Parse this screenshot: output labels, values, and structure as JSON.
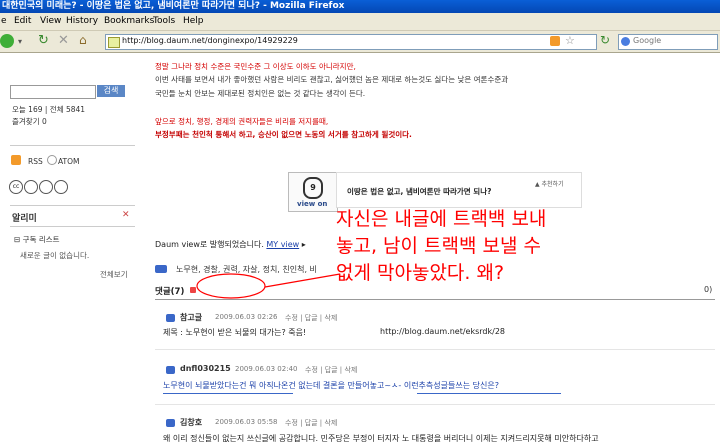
{
  "window": {
    "title": "대한민국의 미래는? - 이땅은 법은 없고, 냄비여론만 따라가면 되나? - Mozilla Firefox"
  },
  "menu": [
    "Edit",
    "View",
    "History",
    "Bookmarks",
    "Tools",
    "Help"
  ],
  "menu_first_partial": "e",
  "toolbar": {
    "url": "http://blog.daum.net/donginexpo/14929229",
    "search_placeholder": "Google"
  },
  "sidebar": {
    "search_button": "검색",
    "stats_today": "오늘 169",
    "stats_total": "전체 5841",
    "favorites": "즐겨찾기 0",
    "rss": "RSS",
    "atom": "ATOM",
    "notice_title": "알리미",
    "subscribe_title": "구독 리스트",
    "subscribe_empty": "새로운 글이 없습니다.",
    "view_all": "전체보기"
  },
  "post": {
    "para1_line1": "정말 그나라 정치 수준은 국민수준 그 이상도 이하도 아니라지만,",
    "para1_line2": "이번 사태를 보면서 내가 좋아했던 사람은 비리도 괜찮고, 싫어했던 놈은 제대로 하는것도 싫다는 낮은 여론수준과",
    "para1_line3": "국민들 눈치 안보는 제대로된 정치인은 없는 것 같다는 생각이 든다.",
    "para2_line1": "앞으로 정치, 행정, 경제의 권력자들은 비리를 저지를때,",
    "para2_line2": "부정부패는 천인척 통해서 하고, 승산이 없으면 노동의 서거를 참고하게 될것이다.",
    "viewon_label": "view on",
    "viewon_count": "9",
    "viewon_title": "이땅은 법은 없고, 냄비여론만 따라가면 되나?",
    "viewon_more": "▲ 추천하기",
    "daum_view_text": "Daum view로 발행되었습니다.",
    "my_view": "MY view",
    "tags": "노무현, 경찰, 권력, 자살, 정치, 친인척, 비",
    "comments_label": "댓글(7)",
    "page_num": "0)"
  },
  "overlay": {
    "line1": "자신은 내글에 트랙백 보내",
    "line2": "놓고, 남이 트랙백 보낼 수",
    "line3": "없게 막아놓았다. 왜?"
  },
  "comments": [
    {
      "author": "참고글",
      "date": "2009.06.03 02:26",
      "actions": "수정 | 답글 | 삭제",
      "body": "제목 : 노무현이 받은 뇌물의 대가는? 죽음!",
      "link": "http://blog.daum.net/eksrdk/28"
    },
    {
      "author": "dnfl030215",
      "date": "2009.06.03 02:40",
      "actions": "수정 | 답글 | 삭제",
      "body": "노무현이 뇌물받았다는건 뭐 아직나온건 없는데 결론을 만들어놓고~ㅅ- 이런추측성글들쓰는 당신은?"
    },
    {
      "author": "김창호",
      "date": "2009.06.03 05:58",
      "actions": "수정 | 답글 | 삭제",
      "body": "왜 이리 정신들이 없는지 쓰신글에 공감합니다. 민주당은 부정이 터지자 노 대통령을 버리더니 이제는 지켜드리지못해 미안하다하고"
    }
  ],
  "colors": {
    "accent_red": "#d40000",
    "link_blue": "#1a3fa8",
    "overlay_red": "#ff0000"
  }
}
